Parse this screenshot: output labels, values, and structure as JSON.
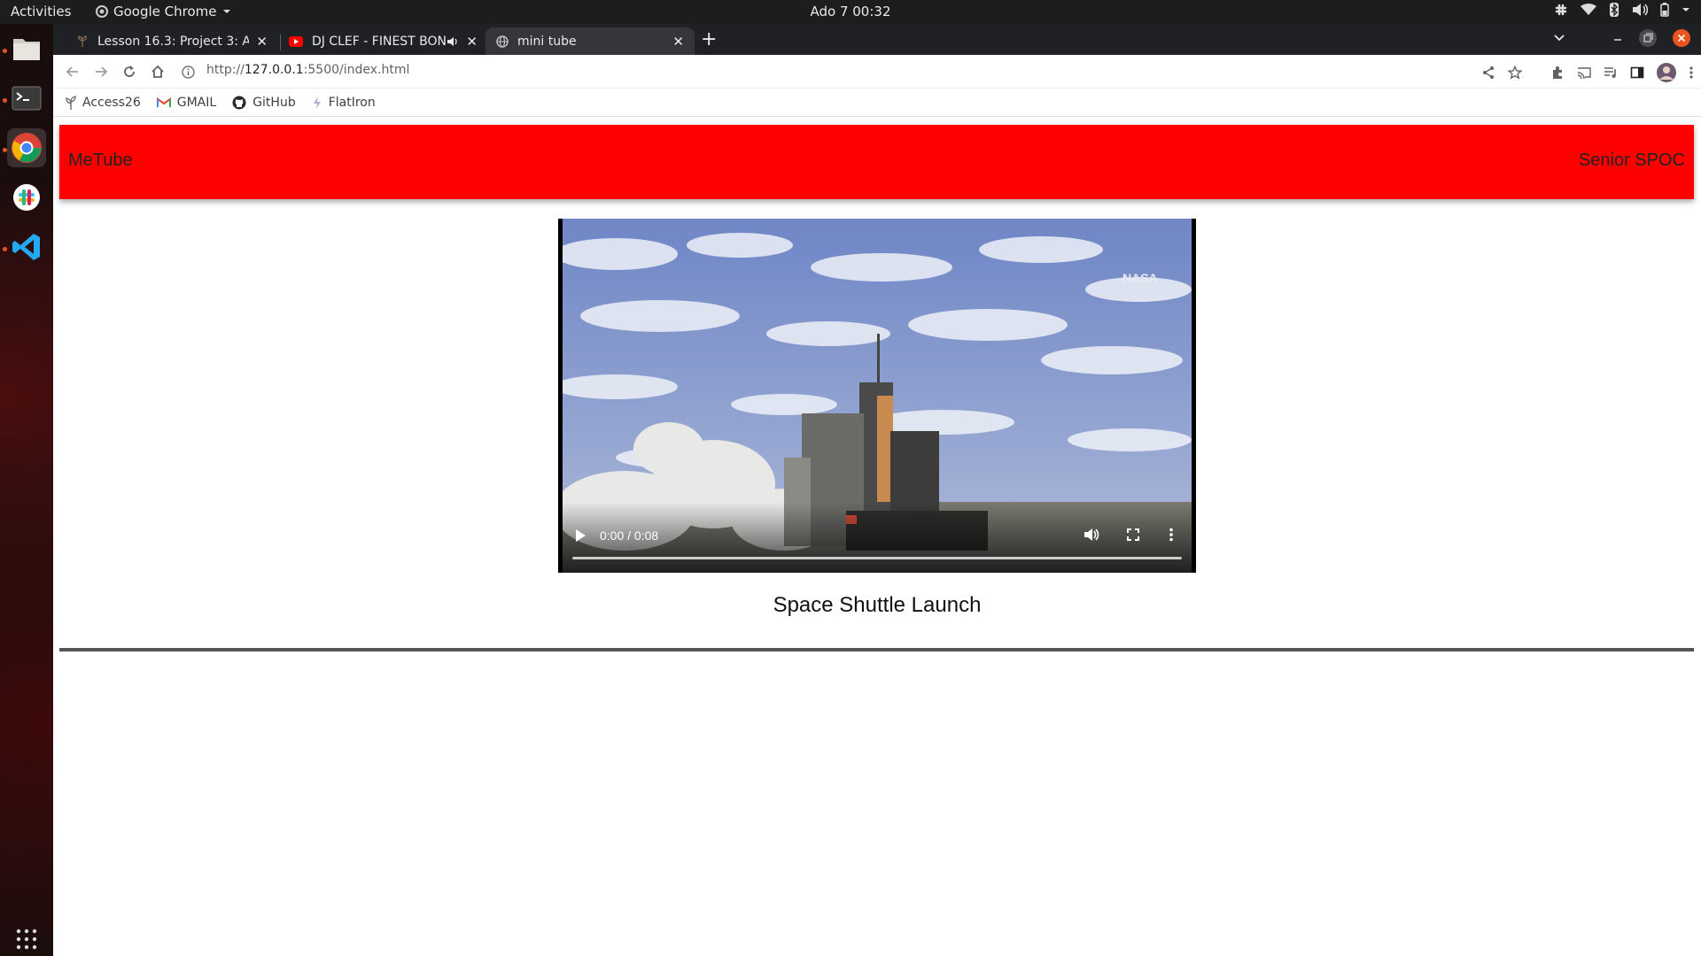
{
  "os": {
    "activities_label": "Activities",
    "app_menu_label": "Google Chrome",
    "clock": "Ado 7  00:32"
  },
  "tabs": [
    {
      "title": "Lesson 16.3: Project 3: Ac",
      "favicon": "leaf-icon",
      "active": false
    },
    {
      "title": "DJ CLEF - FINEST BON",
      "favicon": "youtube-icon",
      "active": false,
      "audio": true
    },
    {
      "title": "mini tube",
      "favicon": "globe-icon",
      "active": true
    }
  ],
  "address": {
    "prefix": "http://",
    "host": "127.0.0.1",
    "suffix": ":5500/index.html"
  },
  "bookmarks": [
    {
      "label": "Access26",
      "icon": "sprout-icon"
    },
    {
      "label": "GMAIL",
      "icon": "gmail-icon"
    },
    {
      "label": "GitHub",
      "icon": "github-icon"
    },
    {
      "label": "FlatIron",
      "icon": "flatiron-icon"
    }
  ],
  "site": {
    "brand": "MeTube",
    "user": "Senior SPOC",
    "header_color": "#ff0000"
  },
  "video": {
    "time_display": "0:00 / 0:08",
    "watermark": "NASA",
    "progress": 0.0
  },
  "caption": "Space Shuttle Launch"
}
